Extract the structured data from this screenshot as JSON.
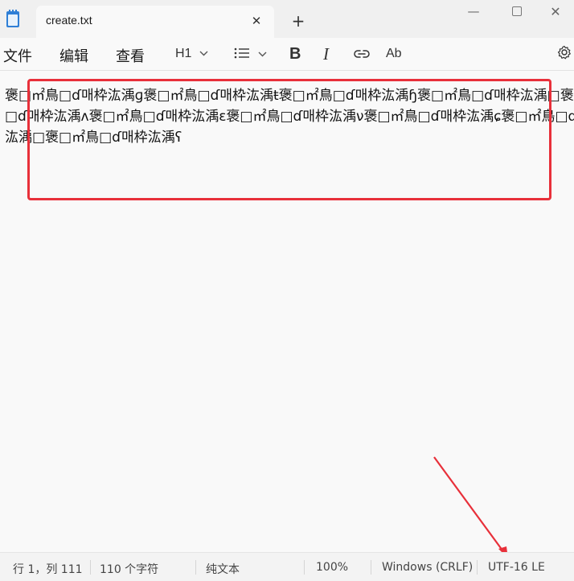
{
  "window": {
    "tab_title": "create.txt",
    "close_tab_glyph": "✕",
    "new_tab_glyph": "+",
    "minimize_glyph": "—",
    "close_glyph": "✕"
  },
  "menu": {
    "file": "文件",
    "edit": "编辑",
    "view": "查看"
  },
  "toolbar": {
    "heading": "H1",
    "bold": "B",
    "italic": "I",
    "spellcheck": "Ab"
  },
  "editor": {
    "content": "褒□㎡鳥□ɗ매枠汯渪ɡ褒□㎡鳥□ɗ매枠汯渪ŧ褒□㎡鳥□ɗ매枠汯渪ɧ褒□㎡鳥□ɗ매枠汯渪□褒□㎡鳥□ɗ매枠汯渪ʌ褒□㎡鳥□ɗ매枠汯渪ɛ褒□㎡鳥□ɗ매枠汯渪ν褒□㎡鳥□ɗ매枠汯渪ɕ褒□㎡鳥□ɗ매枠汯渪□褒□㎡鳥□ɗ매枠汯渪ʕ"
  },
  "status": {
    "position": "行 1，列 111",
    "char_count": "110 个字符",
    "format": "纯文本",
    "zoom": "100%",
    "line_ending": "Windows (CRLF)",
    "encoding": "UTF-16 LE"
  },
  "colors": {
    "annotation": "#e8303a",
    "accent": "#2f7fd6"
  },
  "icons": [
    "notepad-icon",
    "list-icon",
    "link-icon",
    "spellcheck-icon",
    "gear-icon",
    "chevron-down-icon"
  ]
}
